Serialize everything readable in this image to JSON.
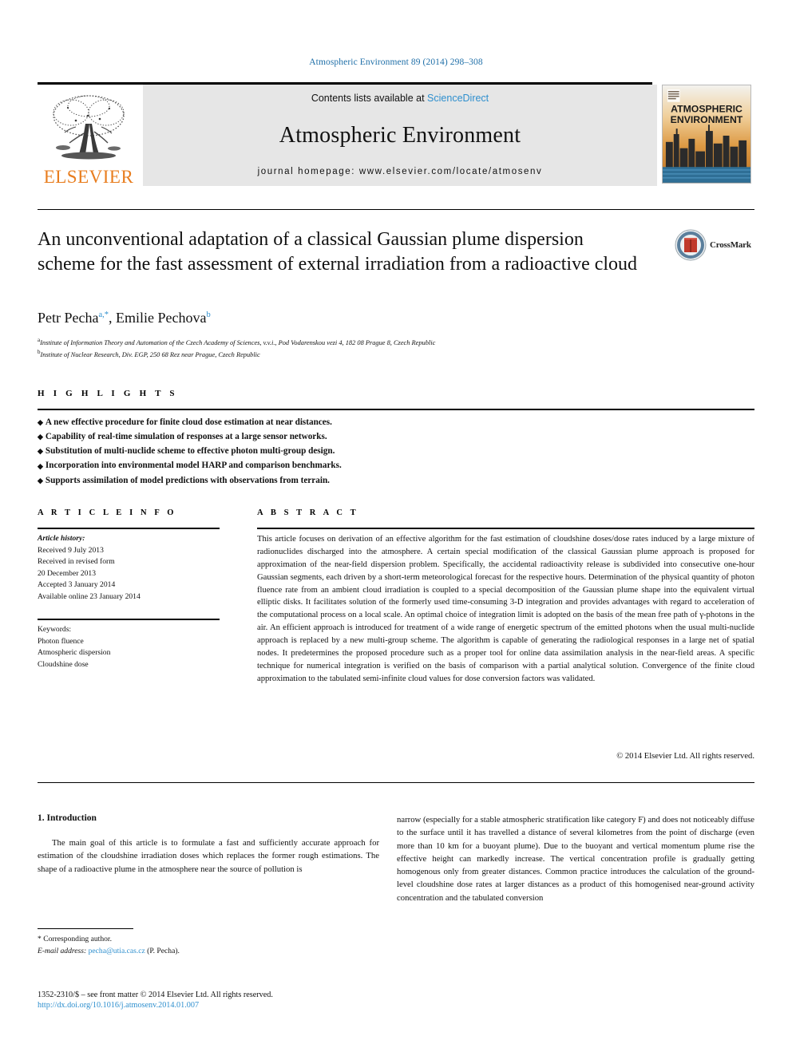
{
  "running_head": "Atmospheric Environment 89 (2014) 298–308",
  "masthead": {
    "publisher_name": "ELSEVIER",
    "contents_prefix": "Contents lists available at",
    "sciencedirect": "ScienceDirect",
    "journal_title": "Atmospheric Environment",
    "homepage": "journal homepage: www.elsevier.com/locate/atmosenv",
    "cover_title_line1": "ATMOSPHERIC",
    "cover_title_line2": "ENVIRONMENT"
  },
  "article": {
    "title": "An unconventional adaptation of a classical Gaussian plume dispersion scheme for the fast assessment of external irradiation from a radioactive cloud",
    "crossmark_label": "CrossMark",
    "authors": [
      {
        "name": "Petr Pecha",
        "marks": "a,*"
      },
      {
        "name": "Emilie Pechova",
        "marks": "b"
      }
    ],
    "affiliations": [
      {
        "mark": "a",
        "text": "Institute of Information Theory and Automation of the Czech Academy of Sciences, v.v.i., Pod Vodarenskou vezi 4, 182 08 Prague 8, Czech Republic"
      },
      {
        "mark": "b",
        "text": "Institute of Nuclear Research, Div. EGP, 250 68 Rez near Prague, Czech Republic"
      }
    ]
  },
  "highlights": {
    "heading": "H I G H L I G H T S",
    "items": [
      "A new effective procedure for finite cloud dose estimation at near distances.",
      "Capability of real-time simulation of responses at a large sensor networks.",
      "Substitution of multi-nuclide scheme to effective photon multi-group design.",
      "Incorporation into environmental model HARP and comparison benchmarks.",
      "Supports assimilation of model predictions with observations from terrain."
    ]
  },
  "article_info": {
    "heading": "A R T I C L E  I N F O",
    "history_label": "Article history:",
    "history": [
      "Received 9 July 2013",
      "Received in revised form",
      "20 December 2013",
      "Accepted 3 January 2014",
      "Available online 23 January 2014"
    ],
    "keywords_label": "Keywords:",
    "keywords": [
      "Photon fluence",
      "Atmospheric dispersion",
      "Cloudshine dose"
    ]
  },
  "abstract": {
    "heading": "A B S T R A C T",
    "text": "This article focuses on derivation of an effective algorithm for the fast estimation of cloudshine doses/dose rates induced by a large mixture of radionuclides discharged into the atmosphere. A certain special modification of the classical Gaussian plume approach is proposed for approximation of the near-field dispersion problem. Specifically, the accidental radioactivity release is subdivided into consecutive one-hour Gaussian segments, each driven by a short-term meteorological forecast for the respective hours. Determination of the physical quantity of photon fluence rate from an ambient cloud irradiation is coupled to a special decomposition of the Gaussian plume shape into the equivalent virtual elliptic disks. It facilitates solution of the formerly used time-consuming 3-D integration and provides advantages with regard to acceleration of the computational process on a local scale. An optimal choice of integration limit is adopted on the basis of the mean free path of γ-photons in the air. An efficient approach is introduced for treatment of a wide range of energetic spectrum of the emitted photons when the usual multi-nuclide approach is replaced by a new multi-group scheme. The algorithm is capable of generating the radiological responses in a large net of spatial nodes. It predetermines the proposed procedure such as a proper tool for online data assimilation analysis in the near-field areas. A specific technique for numerical integration is verified on the basis of comparison with a partial analytical solution. Convergence of the finite cloud approximation to the tabulated semi-infinite cloud values for dose conversion factors was validated.",
    "copyright": "© 2014 Elsevier Ltd. All rights reserved."
  },
  "body": {
    "section_number_title": "1.  Introduction",
    "left_paragraph": "The main goal of this article is to formulate a fast and sufficiently accurate approach for estimation of the cloudshine irradiation doses which replaces the former rough estimations. The shape of a radioactive plume in the atmosphere near the source of pollution is",
    "right_paragraph": "narrow (especially for a stable atmospheric stratification like category F) and does not noticeably diffuse to the surface until it has travelled a distance of several kilometres from the point of discharge (even more than 10 km for a buoyant plume). Due to the buoyant and vertical momentum plume rise the effective height can markedly increase. The vertical concentration profile is gradually getting homogenous only from greater distances. Common practice introduces the calculation of the ground-level cloudshine dose rates at larger distances as a product of this homogenised near-ground activity concentration and the tabulated conversion"
  },
  "footer": {
    "corresponding_author": "* Corresponding author.",
    "email_label": "E-mail address:",
    "email": "pecha@utia.cas.cz",
    "email_suffix": "(P. Pecha).",
    "issn_line": "1352-2310/$ – see front matter © 2014 Elsevier Ltd. All rights reserved.",
    "doi": "http://dx.doi.org/10.1016/j.atmosenv.2014.01.007"
  },
  "colors": {
    "link": "#2e8fce",
    "elsevier_orange": "#E87D1E",
    "runhead": "#1f6fa8",
    "banner_grey": "#e6e6e6"
  }
}
